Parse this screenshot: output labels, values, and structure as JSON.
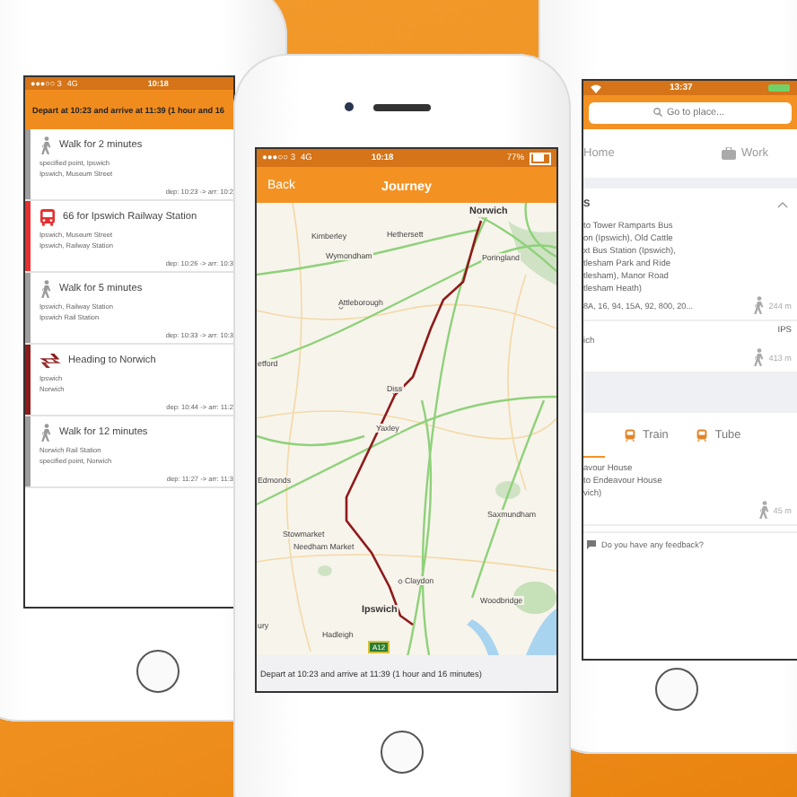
{
  "left_phone": {
    "status_bar": {
      "carrier": "●●●○○ 3",
      "network": "4G",
      "time": "10:18"
    },
    "header": "Depart at 10:23 and arrive at 11:39 (1 hour and 16",
    "steps": [
      {
        "kind": "walk",
        "color": "#9e9e9e",
        "title": "Walk for 2 minutes",
        "from": "specified point, Ipswich",
        "to": "Ipswich, Museum Street",
        "times": "dep: 10:23 -> arr: 10:2"
      },
      {
        "kind": "bus",
        "color": "#e53030",
        "title": "66 for Ipswich Railway Station",
        "from": "Ipswich, Museum Street",
        "to": "Ipswich, Railway Station",
        "times": "dep: 10:26 -> arr: 10:3"
      },
      {
        "kind": "walk",
        "color": "#9e9e9e",
        "title": "Walk for 5 minutes",
        "from": "Ipswich, Railway Station",
        "to": "Ipswich Rail Station",
        "times": "dep: 10:33 -> arr: 10:3"
      },
      {
        "kind": "train",
        "color": "#8c1c1c",
        "title": "Heading to Norwich",
        "from": "Ipswich",
        "to": "Norwich",
        "times": "dep: 10:44 -> arr: 11:2"
      },
      {
        "kind": "walk",
        "color": "#9e9e9e",
        "title": "Walk for 12 minutes",
        "from": "Norwich Rail Station",
        "to": "specified point, Norwich",
        "times": "dep: 11:27 -> arr: 11:3"
      }
    ]
  },
  "center_phone": {
    "status_bar": {
      "carrier": "●●●○○ 3",
      "network": "4G",
      "time": "10:18",
      "battery": "77%"
    },
    "nav": {
      "back": "Back",
      "title": "Journey"
    },
    "map": {
      "labels": [
        {
          "kind": "city",
          "text": "Norwich"
        },
        {
          "kind": "town",
          "text": "Kimberley"
        },
        {
          "kind": "town",
          "text": "Hethersett"
        },
        {
          "kind": "town",
          "text": "Wymondham"
        },
        {
          "kind": "town",
          "text": "Poringland"
        },
        {
          "kind": "town",
          "text": "Attleborough"
        },
        {
          "kind": "town",
          "text": "etford"
        },
        {
          "kind": "town",
          "text": "Diss"
        },
        {
          "kind": "town",
          "text": "Yaxley"
        },
        {
          "kind": "town",
          "text": "Edmonds"
        },
        {
          "kind": "town",
          "text": "Saxmundham"
        },
        {
          "kind": "town",
          "text": "Stowmarket"
        },
        {
          "kind": "town",
          "text": "Needham Market"
        },
        {
          "kind": "town",
          "text": "Claydon"
        },
        {
          "kind": "town",
          "text": "Woodbridge"
        },
        {
          "kind": "city",
          "text": "Ipswich"
        },
        {
          "kind": "town",
          "text": "ury"
        },
        {
          "kind": "town",
          "text": "Hadleigh"
        }
      ],
      "road_sign": "A12"
    },
    "summary": "Depart at 10:23 and arrive at 11:39 (1 hour and 16 minutes)"
  },
  "right_phone": {
    "status_bar": {
      "time": "13:37"
    },
    "search": {
      "placeholder": "Go to place..."
    },
    "shortcuts": [
      {
        "kind": "home",
        "label": "Home"
      },
      {
        "kind": "work",
        "label": "Work"
      }
    ],
    "section": {
      "title": "S",
      "expanded": true
    },
    "stops": [
      {
        "lines": [
          "to Tower Ramparts Bus",
          "on (Ipswich), Old Cattle",
          "xt Bus Station (Ipswich),",
          "tlesham Park and Ride",
          "tlesham), Manor Road",
          "tlesham Heath)"
        ],
        "routes": "8A, 16, 94, 15A, 92, 800, 20...",
        "distance": "244 m"
      },
      {
        "code": "IPS",
        "lines": [
          "ich"
        ],
        "distance": "413 m"
      }
    ],
    "modes": [
      {
        "kind": "hidden",
        "selected": true
      },
      {
        "kind": "train",
        "label": "Train",
        "selected": false
      },
      {
        "kind": "tube",
        "label": "Tube",
        "selected": false
      }
    ],
    "place": {
      "lines": [
        "avour House",
        "to Endeavour House",
        "vich)"
      ],
      "distance": "45 m"
    },
    "feedback": "Do you have any feedback?"
  }
}
